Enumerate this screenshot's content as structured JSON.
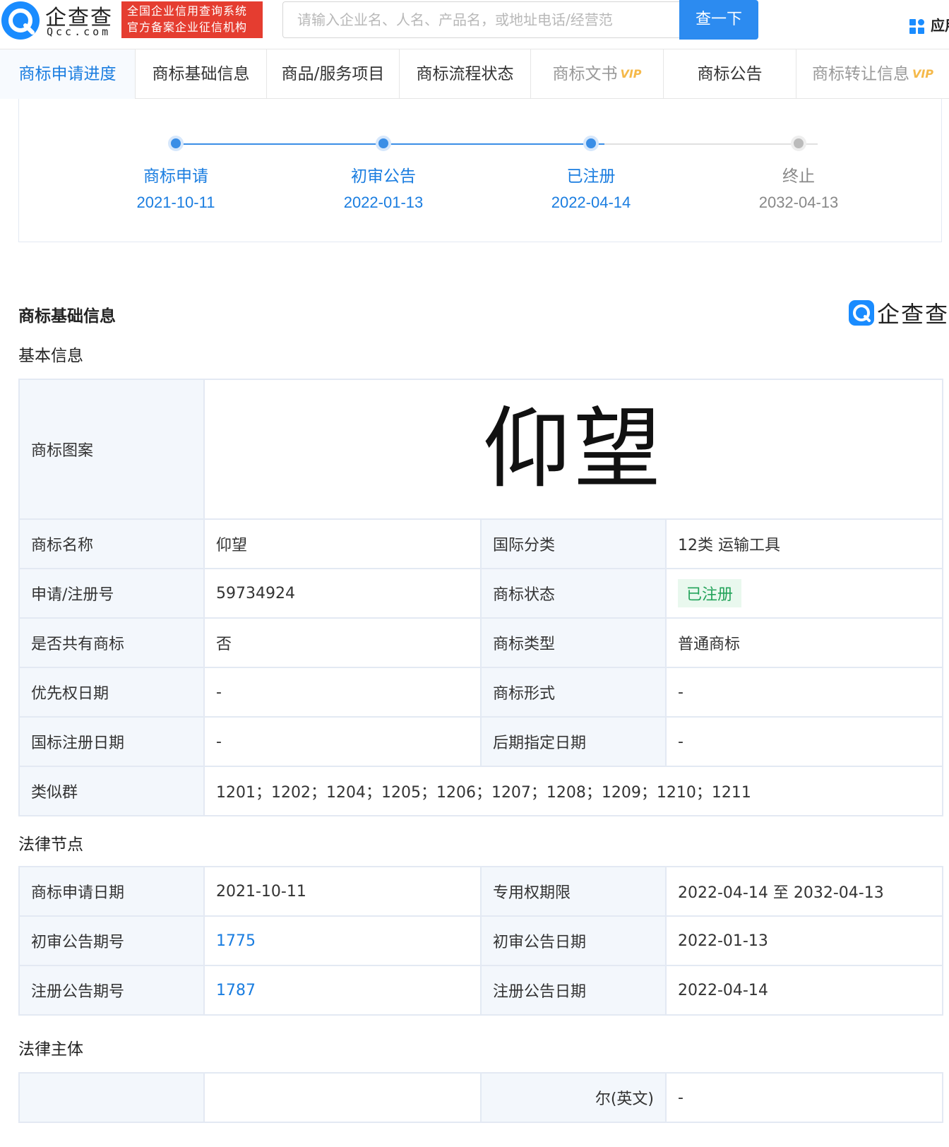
{
  "header": {
    "logo_cn": "企查查",
    "logo_en": "Qcc.com",
    "badge_line1": "全国企业信用查询系统",
    "badge_line2": "官方备案企业征信机构",
    "search_placeholder": "请输入企业名、人名、产品名，或地址电话/经营范",
    "search_button": "查一下",
    "app_label": "应用"
  },
  "tabs": [
    {
      "label": "商标申请进度",
      "state": "active"
    },
    {
      "label": "商标基础信息",
      "state": "normal"
    },
    {
      "label": "商品/服务项目",
      "state": "normal"
    },
    {
      "label": "商标流程状态",
      "state": "normal"
    },
    {
      "label": "商标文书",
      "state": "disabled",
      "vip": "VIP"
    },
    {
      "label": "商标公告",
      "state": "normal"
    },
    {
      "label": "商标转让信息",
      "state": "disabled",
      "vip": "VIP"
    }
  ],
  "progress": {
    "steps": [
      {
        "label": "商标申请",
        "date": "2021-10-11",
        "done": true
      },
      {
        "label": "初审公告",
        "date": "2022-01-13",
        "done": true
      },
      {
        "label": "已注册",
        "date": "2022-04-14",
        "done": true
      },
      {
        "label": "终止",
        "date": "2032-04-13",
        "done": false
      }
    ]
  },
  "basic_section": {
    "title": "商标基础信息",
    "brand_mark": "企查查",
    "subtitle": "基本信息",
    "mark_label": "商标图案",
    "mark_image_text": "仰望",
    "rows": [
      {
        "k1": "商标名称",
        "v1": "仰望",
        "k2": "国际分类",
        "v2": "12类 运输工具"
      },
      {
        "k1": "申请/注册号",
        "v1": "59734924",
        "k2": "商标状态",
        "v2": "已注册"
      },
      {
        "k1": "是否共有商标",
        "v1": "否",
        "k2": "商标类型",
        "v2": "普通商标"
      },
      {
        "k1": "优先权日期",
        "v1": "-",
        "k2": "商标形式",
        "v2": "-"
      },
      {
        "k1": "国标注册日期",
        "v1": "-",
        "k2": "后期指定日期",
        "v2": "-"
      }
    ],
    "similar_group_label": "类似群",
    "similar_group_value": "1201；1202；1204；1205；1206；1207；1208；1209；1210；1211",
    "status_color": "#23a35a"
  },
  "legal_nodes": {
    "title": "法律节点",
    "rows": [
      {
        "k1": "商标申请日期",
        "v1": "2021-10-11",
        "k2": "专用权期限",
        "v2": "2022-04-14 至 2032-04-13"
      },
      {
        "k1": "初审公告期号",
        "v1": "1775",
        "k2": "初审公告日期",
        "v2": "2022-01-13"
      },
      {
        "k1": "注册公告期号",
        "v1": "1787",
        "k2": "注册公告日期",
        "v2": "2022-04-14"
      }
    ]
  },
  "legal_subject": {
    "title": "法律主体",
    "partial_label": "尔(英文)",
    "value": "-"
  },
  "colors": {
    "accent": "#1a7de0",
    "search_button": "#2c8bf0",
    "badge": "#e53d30",
    "key_cell_bg": "#f3f7fc"
  }
}
